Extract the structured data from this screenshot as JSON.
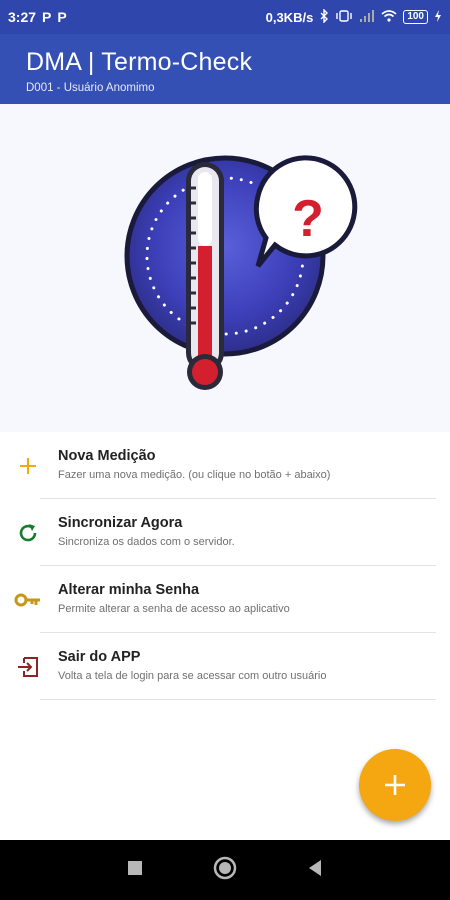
{
  "status_bar": {
    "time": "3:27",
    "notif_1": "P",
    "notif_2": "P",
    "net_speed": "0,3KB/s",
    "battery": "100"
  },
  "app_bar": {
    "title": "DMA | Termo-Check",
    "subtitle": "D001 - Usuário Anomimo"
  },
  "hero": {
    "question_mark": "?"
  },
  "menu": {
    "items": [
      {
        "title": "Nova Medição",
        "desc": "Fazer uma nova medição. (ou clique no botão + abaixo)",
        "icon": "plus-icon"
      },
      {
        "title": "Sincronizar Agora",
        "desc": "Sincroniza os dados com o servidor.",
        "icon": "sync-icon"
      },
      {
        "title": "Alterar minha Senha",
        "desc": "Permite alterar a senha de acesso ao aplicativo",
        "icon": "key-icon"
      },
      {
        "title": "Sair do APP",
        "desc": "Volta a tela de login para se acessar com outro usuário",
        "icon": "exit-icon"
      }
    ]
  },
  "colors": {
    "primary": "#3450b4",
    "status_bar": "#2f47ad",
    "accent": "#f5a712",
    "sync_green": "#1a7a2e",
    "key_gold": "#c8961a",
    "exit_red": "#8b2525"
  }
}
